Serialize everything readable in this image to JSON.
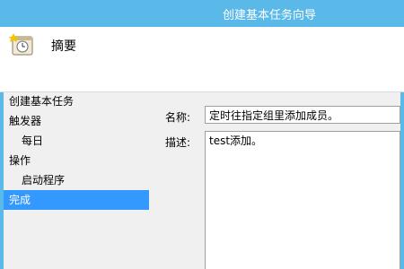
{
  "window": {
    "title": "创建基本任务向导"
  },
  "header": {
    "title": "摘要",
    "icon": "task-clock-icon"
  },
  "nav": {
    "items": [
      {
        "label": "创建基本任务",
        "sub": false,
        "selected": false
      },
      {
        "label": "触发器",
        "sub": false,
        "selected": false
      },
      {
        "label": "每日",
        "sub": true,
        "selected": false
      },
      {
        "label": "操作",
        "sub": false,
        "selected": false
      },
      {
        "label": "启动程序",
        "sub": true,
        "selected": false
      },
      {
        "label": "完成",
        "sub": false,
        "selected": true
      }
    ]
  },
  "form": {
    "name_label": "名称:",
    "name_value": "定时往指定组里添加成员。",
    "desc_label": "描述:",
    "desc_value": "test添加。"
  },
  "colors": {
    "frame": "#5ab9e8",
    "selected": "#3399ff"
  }
}
